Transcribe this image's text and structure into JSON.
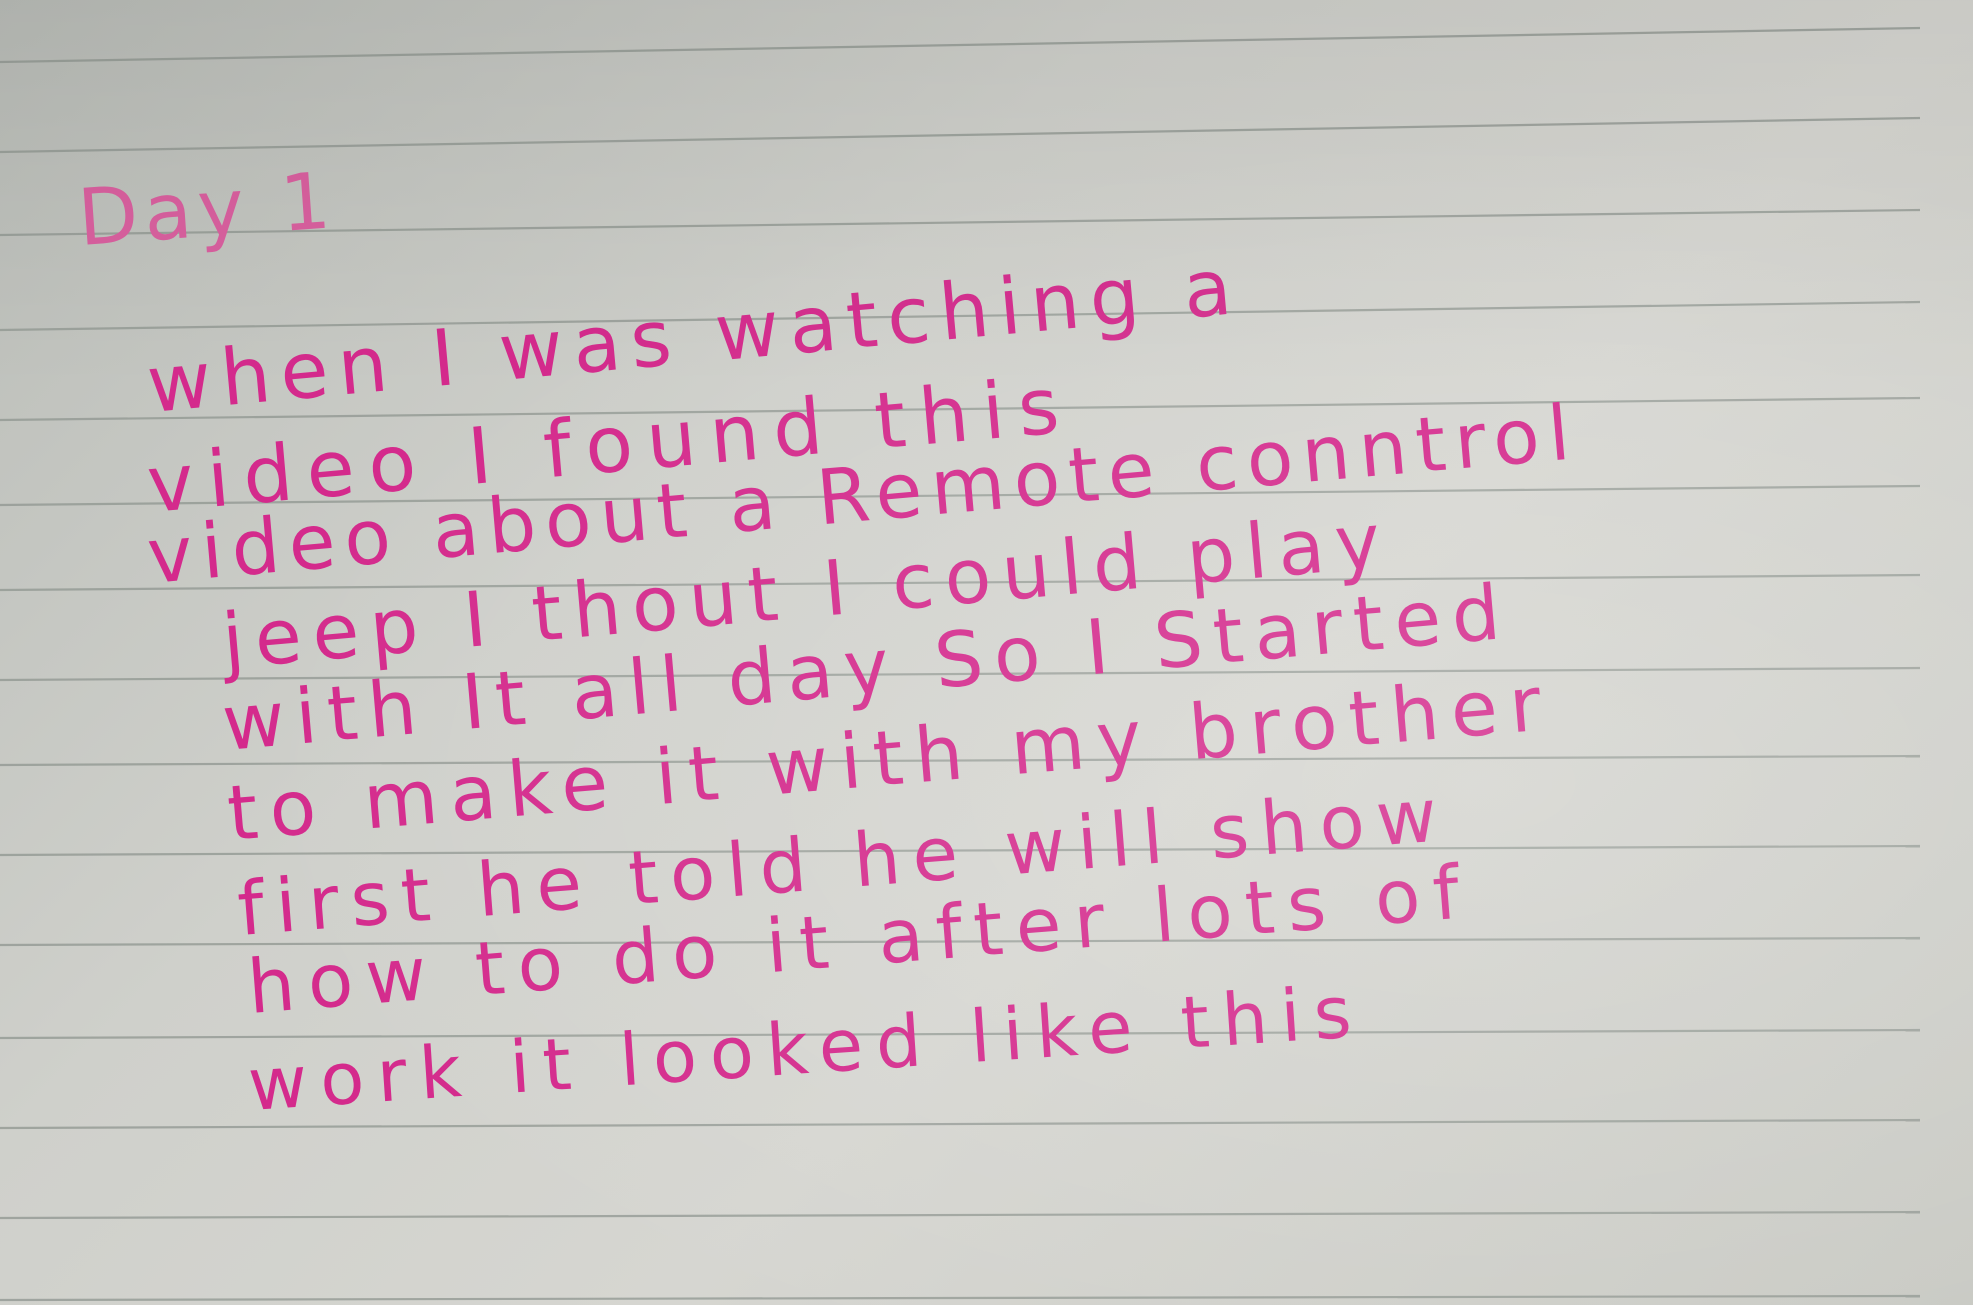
{
  "note": {
    "heading": "Day 1",
    "lines": [
      "when I was watching a",
      "video I found this",
      "video about a Remote conntrol",
      "jeep I thout I could play",
      "with It all day So I Started",
      "to make it with my brother",
      "first he told he will show",
      "how to do it after lots of",
      "work it looked like this"
    ]
  },
  "colors": {
    "ink": "#d42a8c",
    "paper": "#cfd0cb",
    "rule": "#8f9690"
  }
}
